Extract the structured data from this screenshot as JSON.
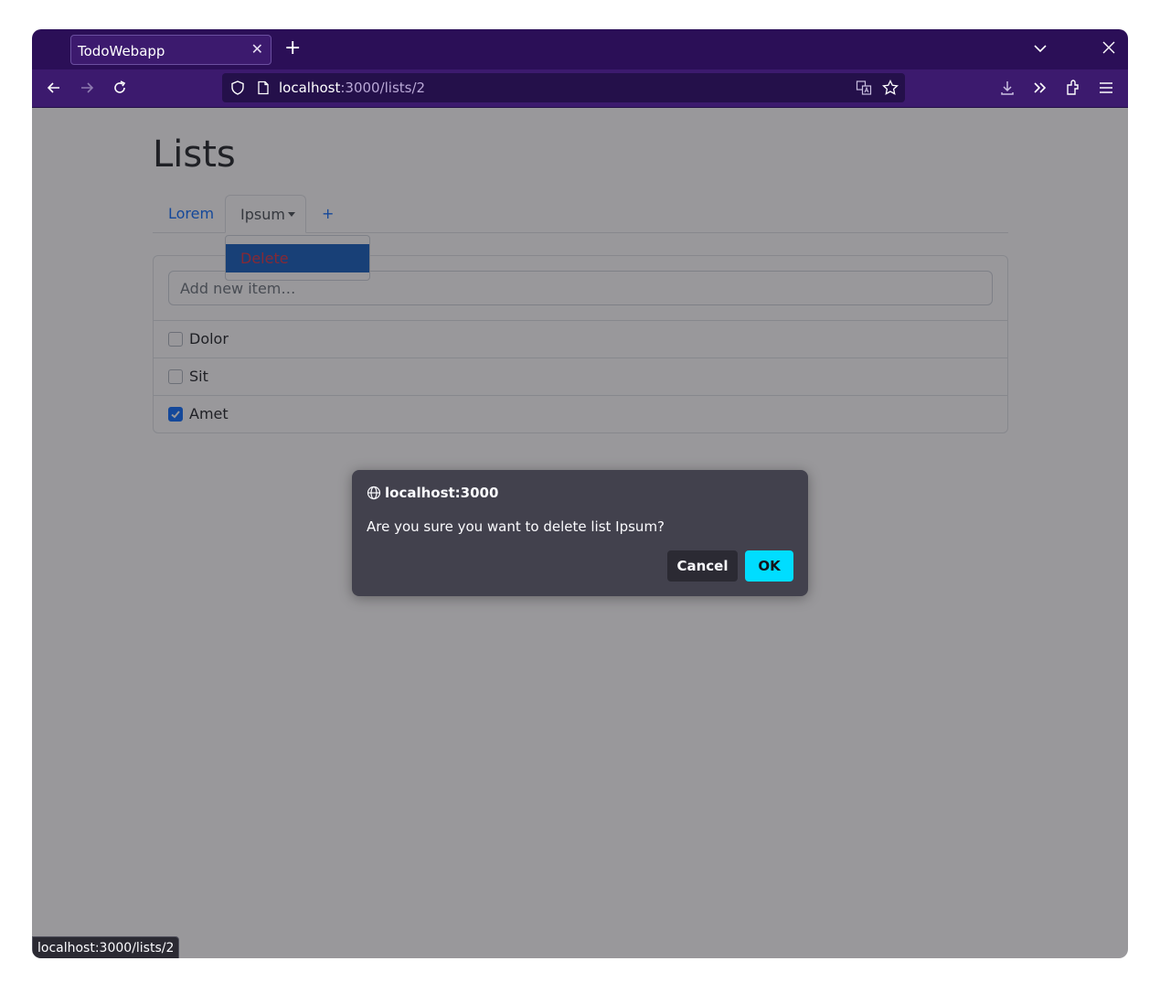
{
  "browser": {
    "tab_title": "TodoWebapp",
    "tab_close_glyph": "✕",
    "new_tab_glyph": "+",
    "url_host": "localhost",
    "url_path": ":3000/lists/2",
    "status_url": "localhost:3000/lists/2",
    "colors": {
      "tabstrip": "#2b0f57",
      "toolbar": "#3c1a6e",
      "urlbar": "#24104a"
    }
  },
  "page": {
    "title": "Lists",
    "tabs": [
      {
        "label": "Lorem",
        "active": false
      },
      {
        "label": "Ipsum",
        "active": true,
        "has_dropdown": true
      },
      {
        "label": "+",
        "active": false
      }
    ],
    "dropdown": {
      "items": [
        {
          "label": "Delete"
        }
      ]
    },
    "add_item": {
      "placeholder": "Add new item…",
      "value": ""
    },
    "items": [
      {
        "label": "Dolor",
        "checked": false
      },
      {
        "label": "Sit",
        "checked": false
      },
      {
        "label": "Amet",
        "checked": true
      }
    ]
  },
  "dialog": {
    "origin": "localhost:3000",
    "origin_icon": "globe-icon",
    "message": "Are you sure you want to delete list Ipsum?",
    "cancel_label": "Cancel",
    "ok_label": "OK",
    "accent": "#00ddff"
  }
}
